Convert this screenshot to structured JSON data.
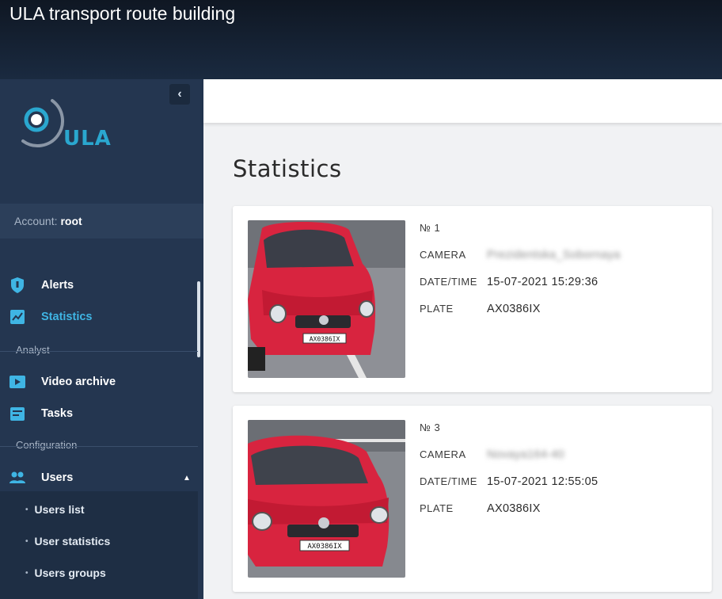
{
  "video_title": "ULA transport route building",
  "sidebar": {
    "logo_text": "ULA",
    "account_label": "Account:",
    "account_user": "root",
    "items": [
      {
        "label": "Alerts",
        "icon": "shield-icon"
      },
      {
        "label": "Statistics",
        "icon": "statistics-icon",
        "active": true
      },
      {
        "label": "Video archive",
        "icon": "video-archive-icon"
      },
      {
        "label": "Tasks",
        "icon": "tasks-icon"
      },
      {
        "label": "Users",
        "icon": "users-icon"
      }
    ],
    "sections": [
      "Analyst",
      "Configuration"
    ],
    "users_subitems": [
      "Users list",
      "User statistics",
      "Users groups"
    ]
  },
  "main": {
    "title": "Statistics",
    "cards": [
      {
        "number": "№ 1",
        "camera_label": "CAMERA",
        "camera_value": "Prezidentska_Sobornaya",
        "datetime_label": "DATE/TIME",
        "datetime_value": "15-07-2021 15:29:36",
        "plate_label": "PLATE",
        "plate_value": "AX0386IX",
        "photo_plate": "AX0386IX"
      },
      {
        "number": "№ 3",
        "camera_label": "CAMERA",
        "camera_value": "Novaya164-40",
        "datetime_label": "DATE/TIME",
        "datetime_value": "15-07-2021 12:55:05",
        "plate_label": "PLATE",
        "plate_value": "AX0386IX",
        "photo_plate": "AX0386IX"
      }
    ]
  },
  "colors": {
    "sidebar_bg": "#243650",
    "accent": "#3fb5e4",
    "car": "#d8243f"
  }
}
